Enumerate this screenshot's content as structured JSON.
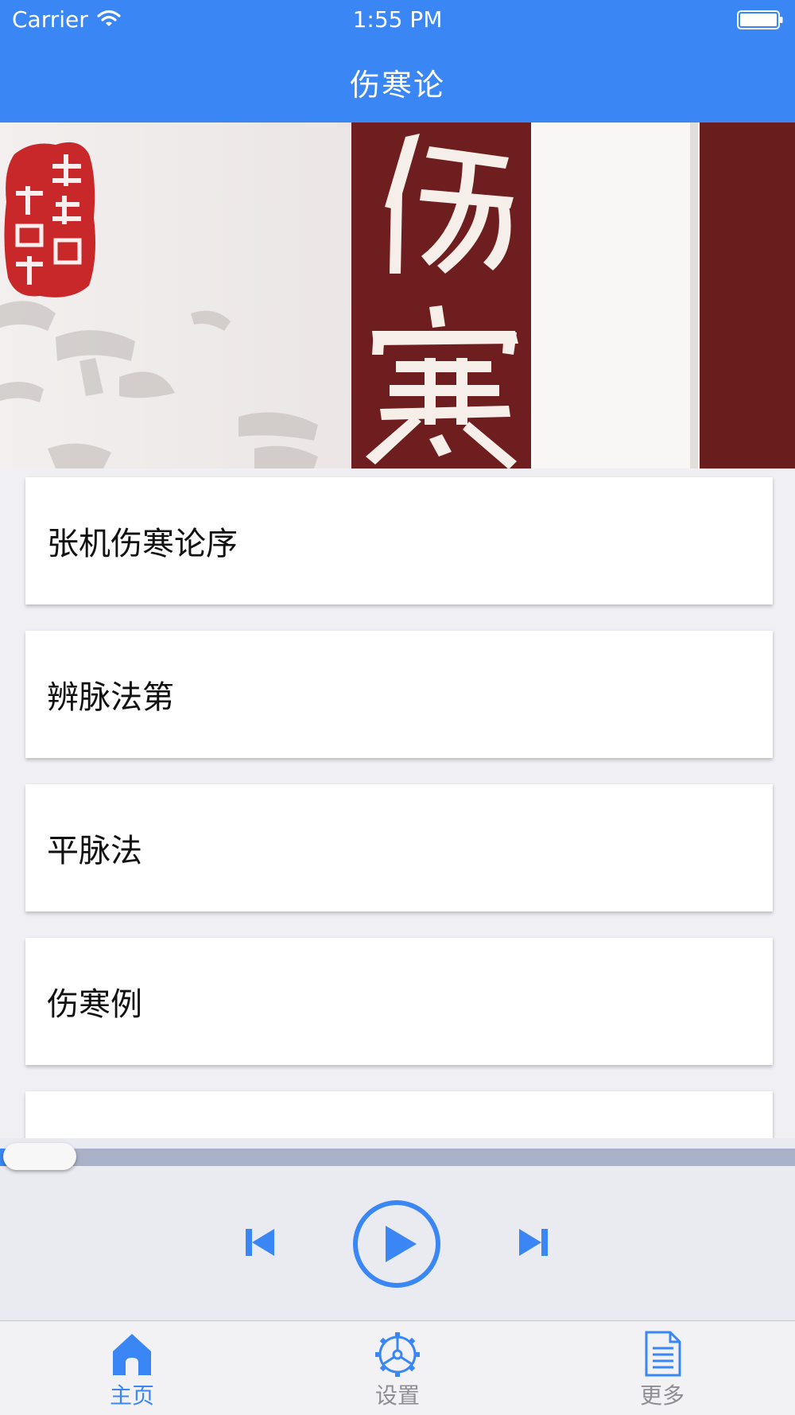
{
  "status_bar": {
    "carrier": "Carrier",
    "time": "1:55 PM"
  },
  "nav": {
    "title": "伤寒论"
  },
  "banner": {
    "seal_text": "读经典做临床",
    "cover_title_chars": [
      "伤",
      "寒"
    ]
  },
  "chapters": [
    {
      "label": "张机伤寒论序"
    },
    {
      "label": "辨脉法第"
    },
    {
      "label": "平脉法"
    },
    {
      "label": "伤寒例"
    },
    {
      "label": ""
    }
  ],
  "player": {
    "progress": 0.0
  },
  "tabs": [
    {
      "label": "主页",
      "icon": "home-icon",
      "selected": true
    },
    {
      "label": "设置",
      "icon": "gear-icon",
      "selected": false
    },
    {
      "label": "更多",
      "icon": "document-icon",
      "selected": false
    }
  ],
  "colors": {
    "accent": "#3a86f5",
    "tab_inactive": "#8e8e93",
    "cover_red": "#6e1e1e",
    "seal_red": "#c8282a"
  }
}
